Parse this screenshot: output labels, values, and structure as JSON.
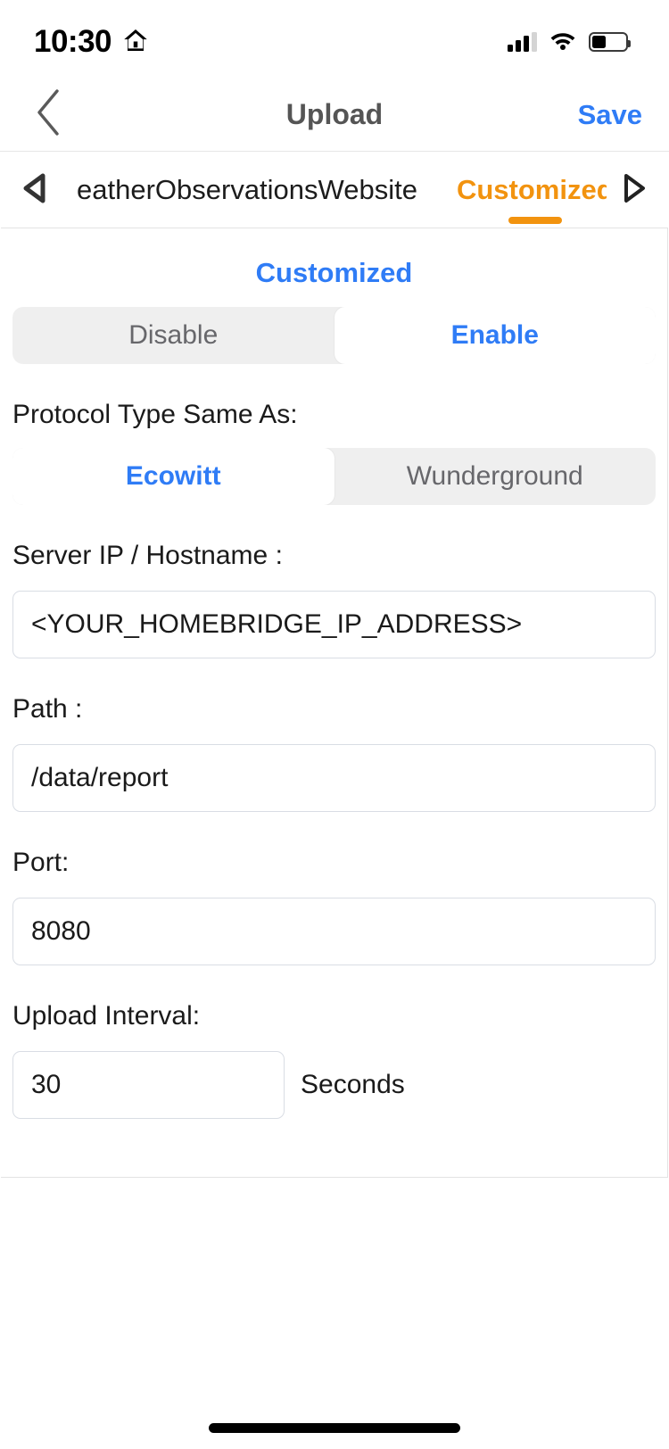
{
  "status_bar": {
    "time": "10:30",
    "home_icon": "home-icon",
    "signal_icon": "cellular-signal-icon",
    "signal_bars_filled": 3,
    "signal_bars_total": 4,
    "wifi_icon": "wifi-icon",
    "battery_icon": "battery-icon",
    "battery_level_percent": 42
  },
  "nav_bar": {
    "back_icon": "chevron-left-icon",
    "title": "Upload",
    "save_label": "Save"
  },
  "tab_strip": {
    "prev_icon": "triangle-left-icon",
    "next_icon": "triangle-right-icon",
    "tabs": [
      {
        "label": "eatherObservationsWebsite",
        "active": false
      },
      {
        "label": "Customized",
        "active": true
      }
    ],
    "active_tab": "Customized"
  },
  "card": {
    "section_title": "Customized",
    "state_toggle": {
      "options": [
        "Disable",
        "Enable"
      ],
      "selected": "Enable"
    },
    "protocol": {
      "label": "Protocol Type Same As:",
      "options": [
        "Ecowitt",
        "Wunderground"
      ],
      "selected": "Ecowitt"
    },
    "server": {
      "label": "Server IP / Hostname :",
      "value": "<YOUR_HOMEBRIDGE_IP_ADDRESS>"
    },
    "path": {
      "label": "Path :",
      "value": "/data/report"
    },
    "port": {
      "label": "Port:",
      "value": "8080"
    },
    "interval": {
      "label": "Upload Interval:",
      "value": "30",
      "unit": "Seconds"
    }
  },
  "colors": {
    "accent_blue": "#2f7cf6",
    "accent_orange": "#f2930f",
    "segment_track": "#efefef",
    "input_border": "#d9dde4",
    "nav_title": "#555555"
  },
  "home_indicator": "home-indicator"
}
